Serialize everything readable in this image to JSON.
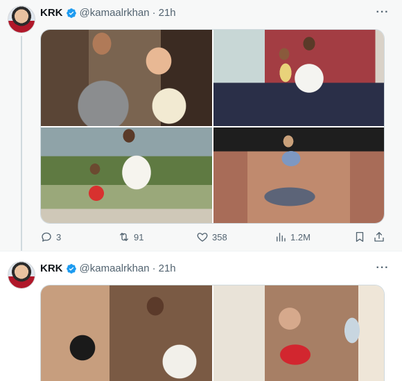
{
  "tweets": [
    {
      "author": {
        "name": "KRK",
        "handle": "@kamaalrkhan",
        "verified": true
      },
      "separator": "·",
      "time": "21h",
      "media_count": 4,
      "stats": {
        "replies": "3",
        "retweets": "91",
        "likes": "358",
        "views": "1.2M"
      }
    },
    {
      "author": {
        "name": "KRK",
        "handle": "@kamaalrkhan",
        "verified": true
      },
      "separator": "·",
      "time": "21h",
      "media_count": 2
    }
  ],
  "icons": {
    "more": "more-horizontal-icon",
    "verified": "verified-badge-icon",
    "reply": "reply-icon",
    "retweet": "retweet-icon",
    "like": "heart-icon",
    "views": "views-chart-icon",
    "bookmark": "bookmark-icon",
    "share": "share-icon"
  },
  "colors": {
    "verified_blue": "#1d9bf0",
    "secondary_text": "#536471",
    "thread_line": "#cfd9de"
  }
}
